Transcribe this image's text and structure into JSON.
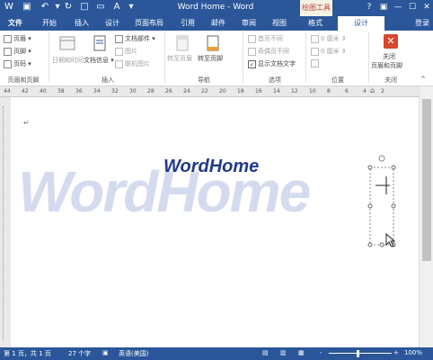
{
  "titlebar": {
    "title": "Word Home - Word",
    "context_tab": "绘图工具",
    "help": "?",
    "minimize": "—",
    "maximize": "☐",
    "close": "✕"
  },
  "tabs": [
    {
      "label": "文件"
    },
    {
      "label": "开始"
    },
    {
      "label": "插入"
    },
    {
      "label": "设计"
    },
    {
      "label": "页面布局"
    },
    {
      "label": "引用"
    },
    {
      "label": "邮件"
    },
    {
      "label": "审阅"
    },
    {
      "label": "视图"
    },
    {
      "label": "格式"
    },
    {
      "label": "设计"
    }
  ],
  "login": "登录",
  "ribbon": {
    "header_footer": {
      "header": "页眉",
      "footer": "页脚",
      "page_number": "页码",
      "group": "页眉和页脚"
    },
    "insert": {
      "datetime": "日期和时间",
      "docinfo": "文档信息",
      "docparts": "文档部件",
      "picture": "图片",
      "online_picture": "联机图片",
      "group": "插入"
    },
    "nav": {
      "goto_header": "转至页眉",
      "goto_footer": "转至页脚",
      "group": "导航"
    },
    "options": {
      "diff_first": "首页不同",
      "diff_odd_even": "奇偶页不同",
      "show_doc_text": "显示文档文字",
      "group": "选项"
    },
    "position": {
      "top_value": "0 厘米",
      "bottom_value": "0 厘米",
      "group": "位置"
    },
    "close": {
      "line1": "关闭",
      "line2": "页眉和页脚",
      "group": "关闭"
    }
  },
  "ruler": [
    "44",
    "42",
    "40",
    "38",
    "36",
    "34",
    "32",
    "30",
    "28",
    "26",
    "24",
    "22",
    "20",
    "18",
    "16",
    "14",
    "12",
    "10",
    "8",
    "6",
    "4",
    "2"
  ],
  "document": {
    "watermark": "WordHome",
    "heading": "WordHome",
    "para_mark": "↵"
  },
  "status": {
    "page": "第 1 页，共 1 页",
    "words": "27 个字",
    "language": "英语(美国)",
    "zoom_minus": "-",
    "zoom_plus": "+",
    "zoom": "100%"
  },
  "colors": {
    "brand": "#2b579a",
    "watermark": "#d5dbef",
    "heading": "#1f3a8a"
  }
}
